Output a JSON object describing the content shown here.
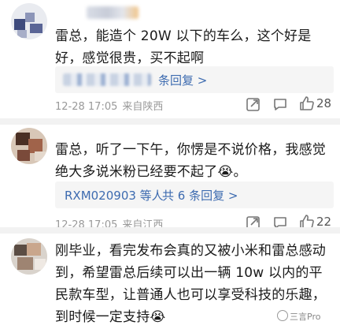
{
  "comments": [
    {
      "text": "雷总，能造个 20W 以下的车么，这个好是好，感觉很贵，买不起啊",
      "reply_link": "条回复 >",
      "timestamp": "12-28 17:05",
      "location": "来自陕西",
      "like_count": "28"
    },
    {
      "text": "雷总，听了一下午，你愣是不说价格，我感觉绝大多说米粉已经要不起了😭。",
      "reply_users": "RXM020903 等人",
      "reply_link": "共 6 条回复 >",
      "timestamp": "12-28 17:05",
      "location": "来自江西",
      "like_count": "22"
    },
    {
      "text": "刚毕业，看完发布会真的又被小米和雷总感动到，希望雷总后续可以出一辆 10w 以内的平民款车型，让普通人也可以享受科技的乐趣，到时候一定支持😭"
    }
  ],
  "watermark": "三言Pro",
  "colors": {
    "link": "#3d6bb0",
    "meta": "#999999",
    "divider": "#f2f2f2"
  },
  "icons": [
    "share-icon",
    "comment-icon",
    "like-icon"
  ]
}
